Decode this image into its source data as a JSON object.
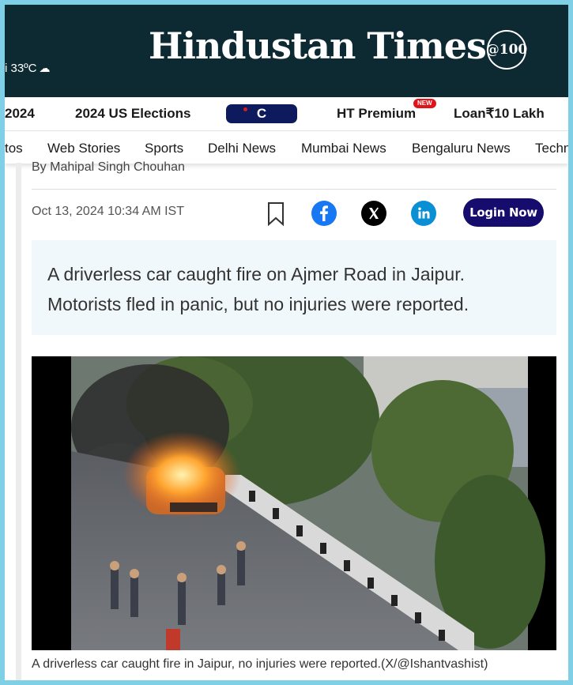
{
  "weather": {
    "temp": "i 33ºC",
    "icon": "cloud-icon"
  },
  "masthead": {
    "logo": "Hindustan Times",
    "anniversary": "@100"
  },
  "nav_primary": [
    {
      "label": "2024"
    },
    {
      "label": "2024 US Elections"
    },
    {
      "label": "C"
    },
    {
      "label": "HT Premium",
      "tag": "NEW"
    },
    {
      "label": "Loan₹10 Lakh"
    }
  ],
  "nav_secondary": [
    {
      "label": "tos"
    },
    {
      "label": "Web Stories"
    },
    {
      "label": "Sports"
    },
    {
      "label": "Delhi News"
    },
    {
      "label": "Mumbai News"
    },
    {
      "label": "Bengaluru News"
    },
    {
      "label": "Techn"
    }
  ],
  "article": {
    "byline": "By Mahipal Singh Chouhan",
    "date": "Oct 13, 2024 10:34 AM IST",
    "login_label": "Login Now",
    "summary": "A driverless car caught fire on Ajmer Road in Jaipur. Motorists fled in panic, but no injuries were reported.",
    "caption": "A driverless car caught fire in Jaipur, no injuries were reported.(X/@Ishantvashist)"
  },
  "colors": {
    "masthead_bg": "#0d2a33",
    "login_bg": "#150c6e",
    "facebook": "#1877f2",
    "linkedin": "#0a8ed4",
    "new_tag": "#e0131a"
  }
}
